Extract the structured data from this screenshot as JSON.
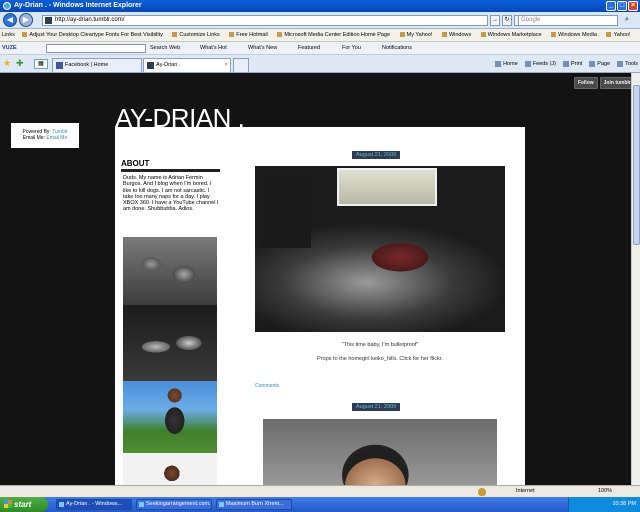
{
  "window": {
    "title": "Ay-Drian . - Windows Internet Explorer"
  },
  "address": {
    "url": "http://ay-drian.tumblr.com/",
    "search_placeholder": "Google"
  },
  "links_bar": {
    "label": "Links",
    "items": [
      "Adjust Your Desktop Cleartype Fonts For Best Visibility",
      "Customize Links",
      "Free Hotmail",
      "Microsoft Media Center Edition Home Page",
      "My Yahoo!",
      "Windows",
      "Windows Marketplace",
      "Windows Media",
      "Yahoo!"
    ]
  },
  "toolbar": {
    "brand": "VUZE",
    "items": [
      "Search Web",
      "What's Hot",
      "What's New",
      "Featured",
      "For You",
      "Notifications"
    ]
  },
  "tabs": [
    {
      "label": "Facebook | Home"
    },
    {
      "label": "Ay-Drian ."
    }
  ],
  "command_bar": [
    "Home",
    "Feeds (J)",
    "Print",
    "Page",
    "Tools"
  ],
  "page": {
    "tumblr_follow": "Follow",
    "tumblr_join": "Join tumblr.",
    "powered_by_label": "Powered By:",
    "powered_by_link": "Tumblr",
    "email_label": "Email Me:",
    "email_link": "Email Me",
    "blog_title": "AY-DRIAN .",
    "about_heading": "ABOUT",
    "about_text": "Duds. My name is Adrian Fermin Burgos. And I blog when I'm bored. I like to kill dogs. I am not sarcastic. I take too many naps for a day. I play XBOX 360. I have a YouTube channel I am done. Shubbubba. Adios.",
    "posts": [
      {
        "date": "August 21, 2009",
        "caption": "\"This time baby, I'm bulletproof\"",
        "credit": "Props to the homegirl keiko_hills. Click for her flickr.",
        "comments": "Comments"
      },
      {
        "date": "August 21, 2009"
      }
    ]
  },
  "status": {
    "zone": "Internet",
    "zoom": "100%"
  },
  "taskbar": {
    "start": "start",
    "items": [
      "Ay-Drian . - Windows...",
      "Seekingarrangement.com...",
      "Maximum Burn Xtrem..."
    ],
    "clock": "10:38 PM"
  }
}
